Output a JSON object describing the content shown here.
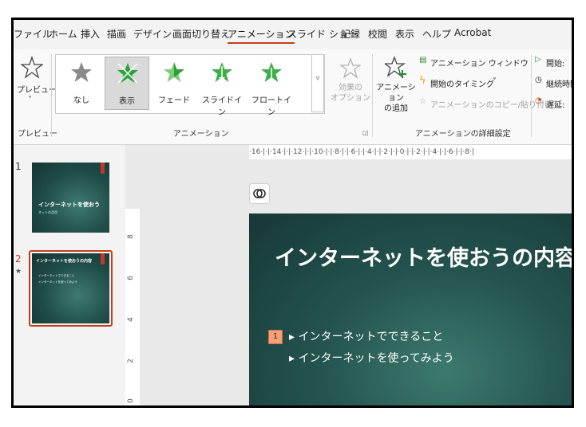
{
  "tabs": [
    "ファイル",
    "ホーム",
    "挿入",
    "描画",
    "デザイン",
    "画面切り替え",
    "アニメーション",
    "スライド ショー",
    "記録",
    "校閲",
    "表示",
    "ヘルプ",
    "Acrobat"
  ],
  "active_tab": "アニメーション",
  "ribbon": {
    "preview_label": "プレビュー",
    "preview_group": "プレビュー",
    "animation_group": "アニメーション",
    "gallery": [
      {
        "label": "なし",
        "color": "#8a8a8a"
      },
      {
        "label": "表示",
        "color": "#2aa33a"
      },
      {
        "label": "フェード",
        "color": "#6cc46c"
      },
      {
        "label": "スライドイン",
        "color": "#3fae48"
      },
      {
        "label": "フロートイン",
        "color": "#3fae48"
      }
    ],
    "effect_options": "効果の\nオプション",
    "add_animation": "アニメーション\nの追加",
    "animation_pane": "アニメーション ウィンドウ",
    "trigger": "開始のタイミング",
    "copy_animation": "アニメーションのコピー/貼り付け",
    "advanced_group": "アニメーションの詳細設定",
    "start": "開始:",
    "duration": "継続時間",
    "delay": "遅延:"
  },
  "thumbnails": [
    {
      "num": "1",
      "title": "インターネットを使おう",
      "subtitle": "ネットの活用"
    },
    {
      "num": "2",
      "title": "インターネットを使おうの内容",
      "bullets": [
        "インターネットでできること",
        "インターネットを使ってみよう"
      ]
    }
  ],
  "ruler": {
    "h": "·16·|·|·14·|·|·12·|·|·10·|·|·8·|·|·6·|·|·4·|·|·2·|·|·0·|·|·2·|·|·4·|·|·6·|·|·8·|",
    "v": [
      "8",
      "6",
      "4",
      "2",
      "0"
    ]
  },
  "slide": {
    "title": "インターネットを使おうの内容",
    "anim_num": "1",
    "bullets": [
      "インターネットでできること",
      "インターネットを使ってみよう"
    ]
  }
}
